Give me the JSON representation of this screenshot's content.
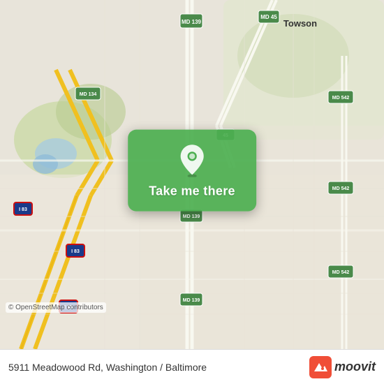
{
  "map": {
    "attribution": "© OpenStreetMap contributors",
    "center_lat": 39.38,
    "center_lng": -76.65
  },
  "popup": {
    "button_label": "Take me there",
    "icon": "location-pin"
  },
  "bottom_bar": {
    "address": "5911 Meadowood Rd, Washington / Baltimore",
    "logo_text": "moovit"
  },
  "road_labels": {
    "md139_top": "MD 139",
    "md139_mid": "MD 139",
    "md139_bot": "MD 139",
    "md45": "MD 45",
    "md134": "MD 134",
    "md542a": "MD 542",
    "md542b": "MD 542",
    "md542c": "MD 542",
    "i83a": "I 83",
    "i83b": "I 83",
    "i83c": "I 83",
    "towson": "Towson"
  }
}
